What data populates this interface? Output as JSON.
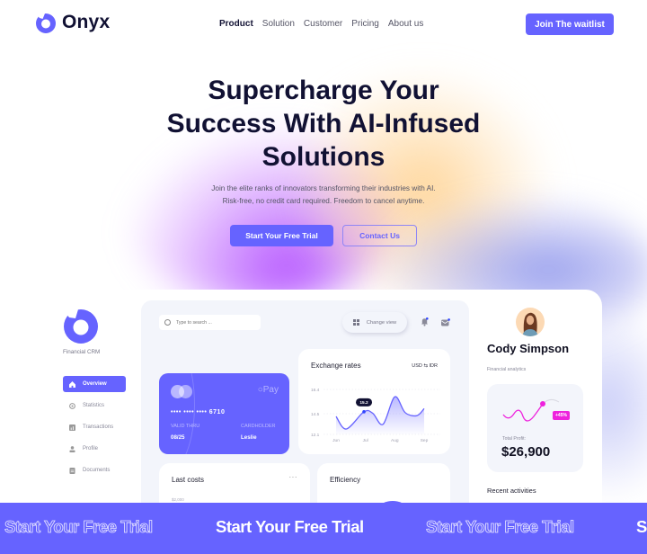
{
  "brand": {
    "name": "Onyx",
    "accent": "#6663ff",
    "pink": "#ee22dd"
  },
  "nav": {
    "links": [
      {
        "label": "Product",
        "active": true
      },
      {
        "label": "Solution",
        "active": false
      },
      {
        "label": "Customer",
        "active": false
      },
      {
        "label": "Pricing",
        "active": false
      },
      {
        "label": "About us",
        "active": false
      }
    ],
    "cta": "Join The waitlist"
  },
  "hero": {
    "title_lines": [
      "Supercharge Your",
      "Success With AI-Infused",
      "Solutions"
    ],
    "subtitle_lines": [
      "Join the elite ranks of innovators transforming their industries with AI.",
      "Risk-free, no credit card required. Freedom to cancel anytime."
    ],
    "primary_cta": "Start Your Free Trial",
    "secondary_cta": "Contact Us"
  },
  "dashboard": {
    "sidebar": {
      "caption": "Financial CRM",
      "items": [
        {
          "label": "Overview",
          "icon": "home-icon",
          "active": true
        },
        {
          "label": "Statistics",
          "icon": "statistics-icon",
          "active": false
        },
        {
          "label": "Transactions",
          "icon": "transactions-icon",
          "active": false
        },
        {
          "label": "Profile",
          "icon": "profile-icon",
          "active": false
        },
        {
          "label": "Documents",
          "icon": "documents-icon",
          "active": false
        }
      ]
    },
    "topbar": {
      "search_placeholder": "Type to search ...",
      "change_view": "Change view"
    },
    "card": {
      "pay": "Pay",
      "number_mask": "•••• •••• ••••",
      "last4": "6710",
      "valid_label": "VALID THRU",
      "valid_value": "08/25",
      "holder_label": "CARDHOLDER",
      "holder_value": "Leslie"
    },
    "exchange": {
      "title": "Exchange rates",
      "pair": "USD ⇆ IDR",
      "tooltip": "15.2"
    },
    "last_costs": {
      "title": "Last costs",
      "more": "···",
      "first_tick": "$2,000"
    },
    "efficiency": {
      "title": "Efficiency"
    },
    "profile": {
      "name": "Cody Simpson",
      "role": "Financial analytics",
      "profit_label": "Total Profit:",
      "profit_value": "$26,900",
      "profit_change": "+45%",
      "recent": "Recent activities"
    }
  },
  "chart_data": {
    "type": "line",
    "title": "Exchange rates",
    "x": [
      "Jun",
      "Jul",
      "Aug",
      "Sep"
    ],
    "y_ticks": [
      "16.4",
      "14.5",
      "12.1"
    ],
    "ylim": [
      11.5,
      17
    ],
    "series": [
      {
        "name": "USD/IDR",
        "points": [
          [
            0.0,
            13.9
          ],
          [
            0.35,
            12.3
          ],
          [
            0.95,
            14.5
          ],
          [
            1.25,
            14.3
          ],
          [
            1.6,
            12.9
          ],
          [
            2.0,
            16.4
          ],
          [
            2.35,
            14.4
          ],
          [
            2.75,
            14.0
          ],
          [
            3.0,
            14.9
          ]
        ]
      }
    ],
    "highlight": {
      "x_index": 1,
      "label": "15.2"
    }
  },
  "band": {
    "items": [
      {
        "text": "Start Your Free Trial",
        "style": "outline"
      },
      {
        "text": "Start Your Free Trial",
        "style": "solid"
      },
      {
        "text": "Start Your Free Trial",
        "style": "outline"
      },
      {
        "text": "Start Your Free Trial",
        "style": "solid"
      }
    ]
  }
}
